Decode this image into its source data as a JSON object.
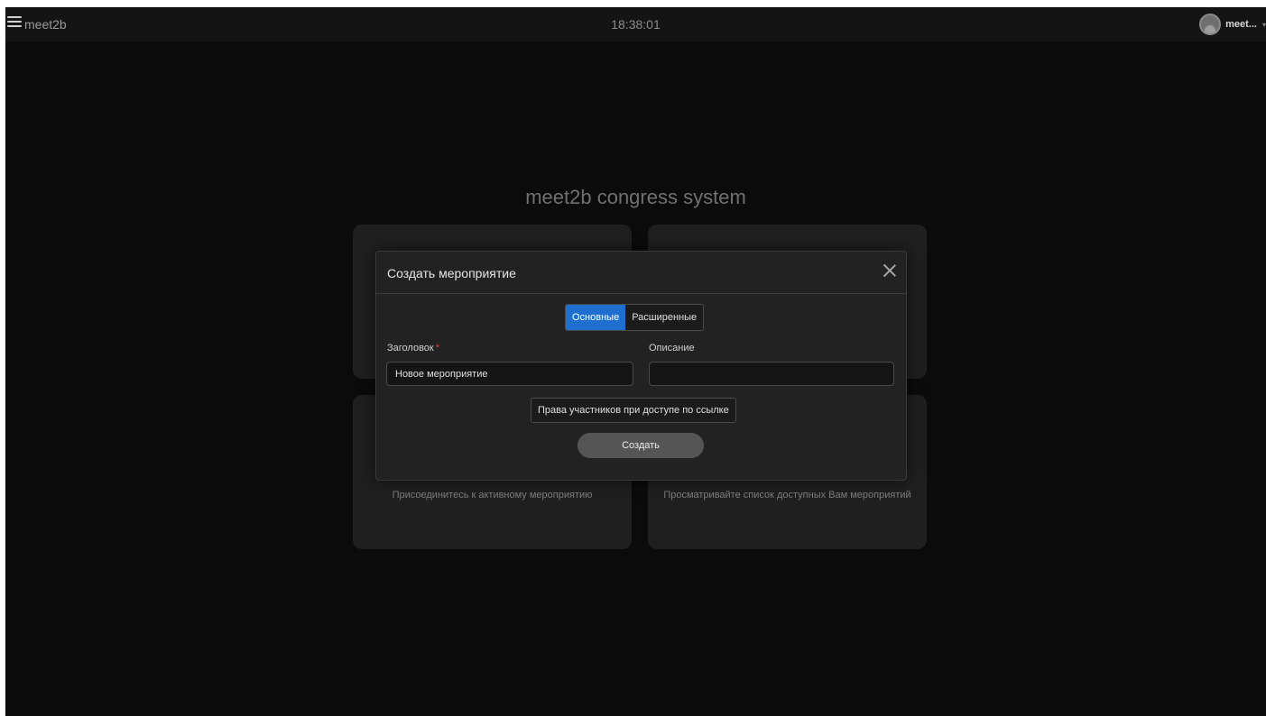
{
  "topbar": {
    "app_name": "meet2b",
    "clock": "18:38:01",
    "user_name": "meet...",
    "caret": "▾"
  },
  "hero": {
    "title": "meet2b congress system"
  },
  "tiles": {
    "join": {
      "description": "Присоединитесь к активному мероприятию"
    },
    "events": {
      "description": "Просматривайте список доступных Вам мероприятий"
    }
  },
  "modal": {
    "title": "Создать мероприятие",
    "tabs": [
      {
        "label": "Основные",
        "active": true
      },
      {
        "label": "Расширенные",
        "active": false
      }
    ],
    "title_field": {
      "label": "Заголовок",
      "required_mark": "*",
      "value": "Новое мероприятие"
    },
    "description_field": {
      "label": "Описание",
      "value": ""
    },
    "rights_button_label": "Права участников при доступе по ссылке",
    "create_button_label": "Создать"
  },
  "colors": {
    "accent": "#1e6fd0",
    "background": "#0b0b0b",
    "modal_bg": "#222222",
    "required": "#e03a3a"
  },
  "icons": [
    "menu-icon",
    "avatar-icon",
    "close-icon"
  ]
}
